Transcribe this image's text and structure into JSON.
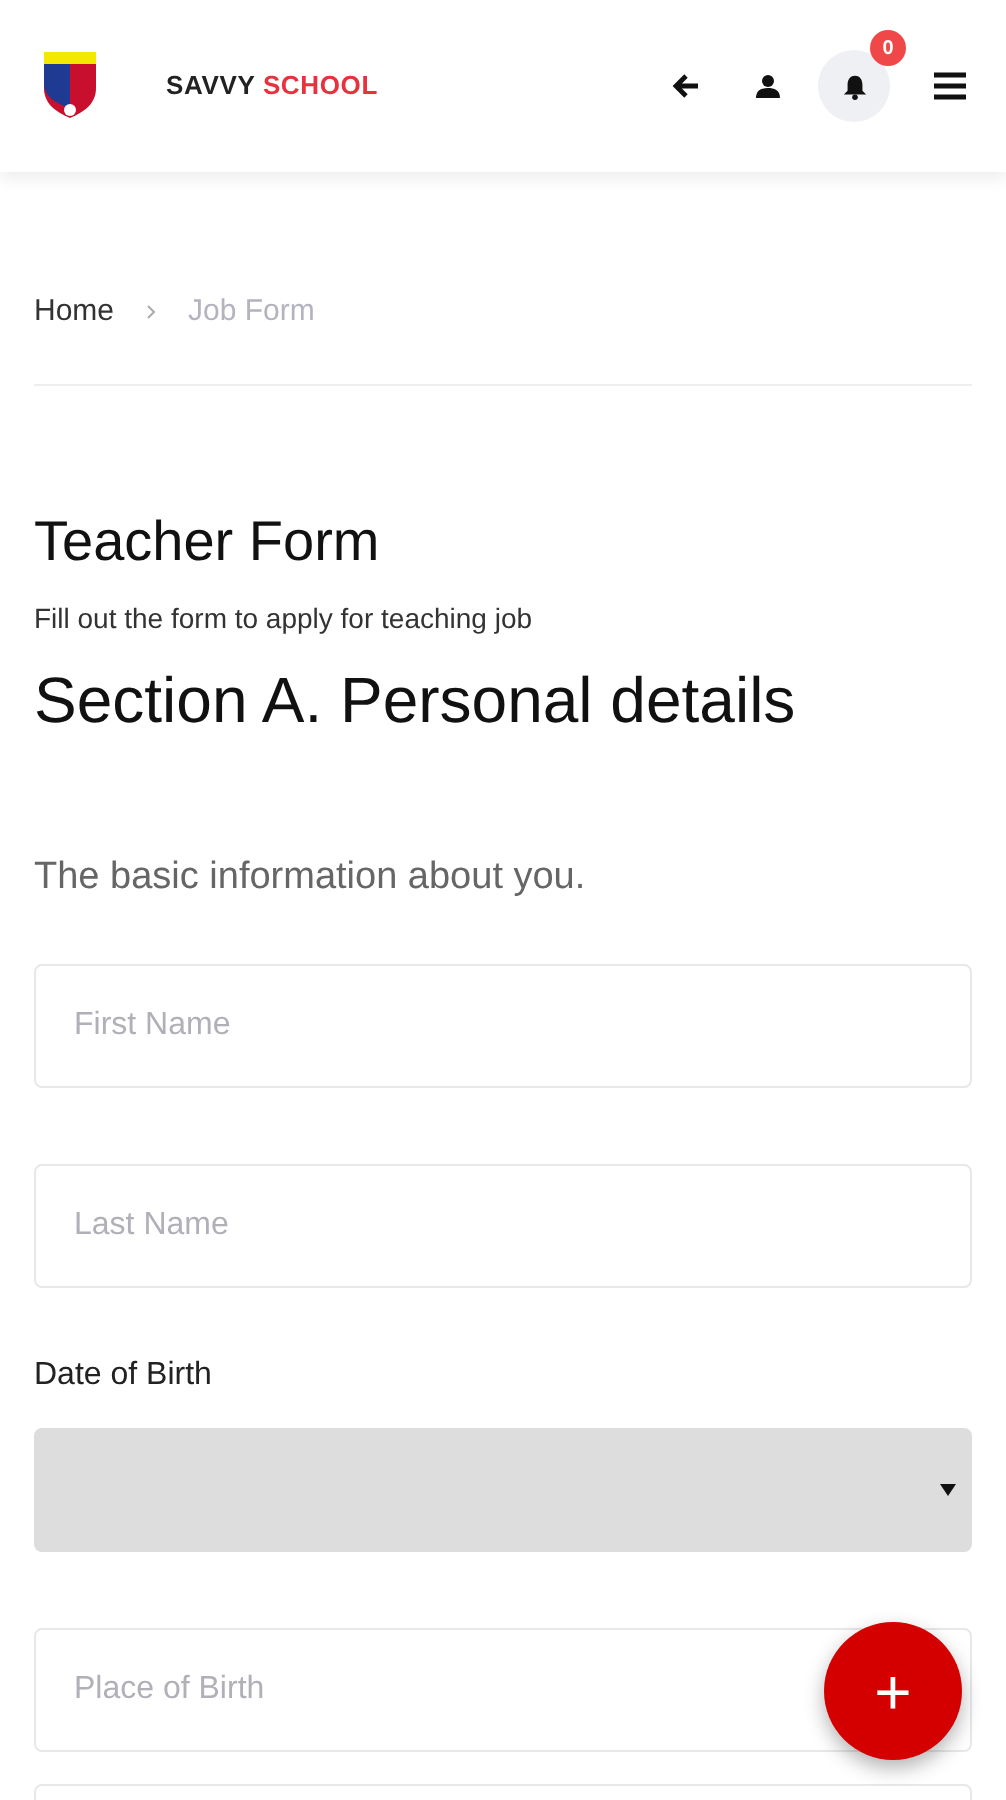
{
  "header": {
    "brand_first": "SAVVY",
    "brand_second": "SCHOOL",
    "notification_count": "0"
  },
  "breadcrumb": [
    {
      "label": "Home",
      "selected": false
    },
    {
      "label": "Job Form",
      "selected": true
    }
  ],
  "form": {
    "title": "Teacher Form",
    "subtitle": "Fill out the form to apply for teaching job",
    "section_title": "Section A. Personal details",
    "section_intro": "The basic information about you.",
    "fields": [
      {
        "kind": "input",
        "placeholder": "First Name"
      },
      {
        "kind": "input",
        "placeholder": "Last Name"
      },
      {
        "kind": "select",
        "label": "Date of Birth"
      },
      {
        "kind": "input",
        "placeholder": "Place of Birth"
      },
      {
        "kind": "input"
      }
    ]
  },
  "fab": {
    "label": "+"
  }
}
